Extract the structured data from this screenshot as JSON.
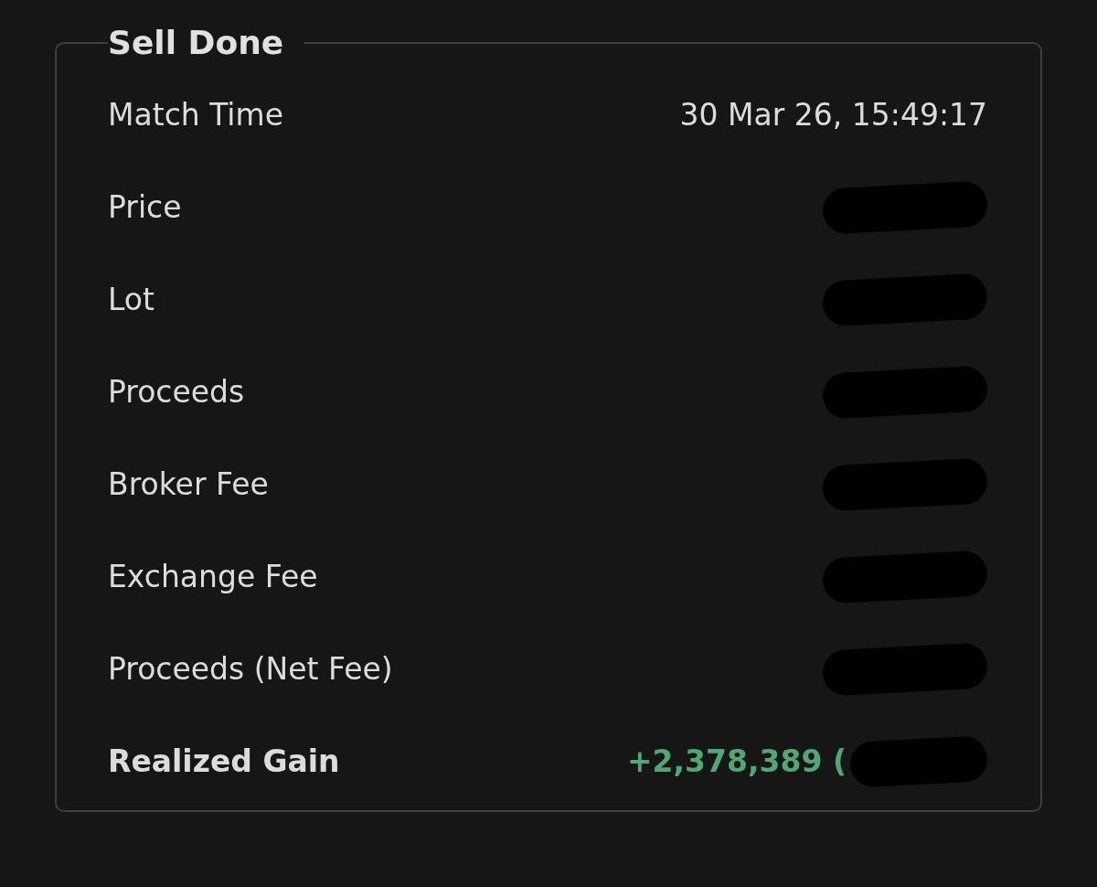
{
  "panel": {
    "title": "Sell Done",
    "rows": [
      {
        "kind": "plain",
        "label": "Match Time",
        "value": "30 Mar 26, 15:49:17",
        "redacted": false
      },
      {
        "kind": "plain",
        "label": "Price",
        "redacted": true
      },
      {
        "kind": "plain",
        "label": "Lot",
        "redacted": true
      },
      {
        "kind": "plain",
        "label": "Proceeds",
        "redacted": true
      },
      {
        "kind": "plain",
        "label": "Broker Fee",
        "redacted": true
      },
      {
        "kind": "plain",
        "label": "Exchange Fee",
        "redacted": true
      },
      {
        "kind": "plain",
        "label": "Proceeds (Net Fee)",
        "redacted": true
      },
      {
        "kind": "gain",
        "label": "Realized Gain",
        "value": "+2,378,389 (",
        "redacted": true
      }
    ]
  }
}
